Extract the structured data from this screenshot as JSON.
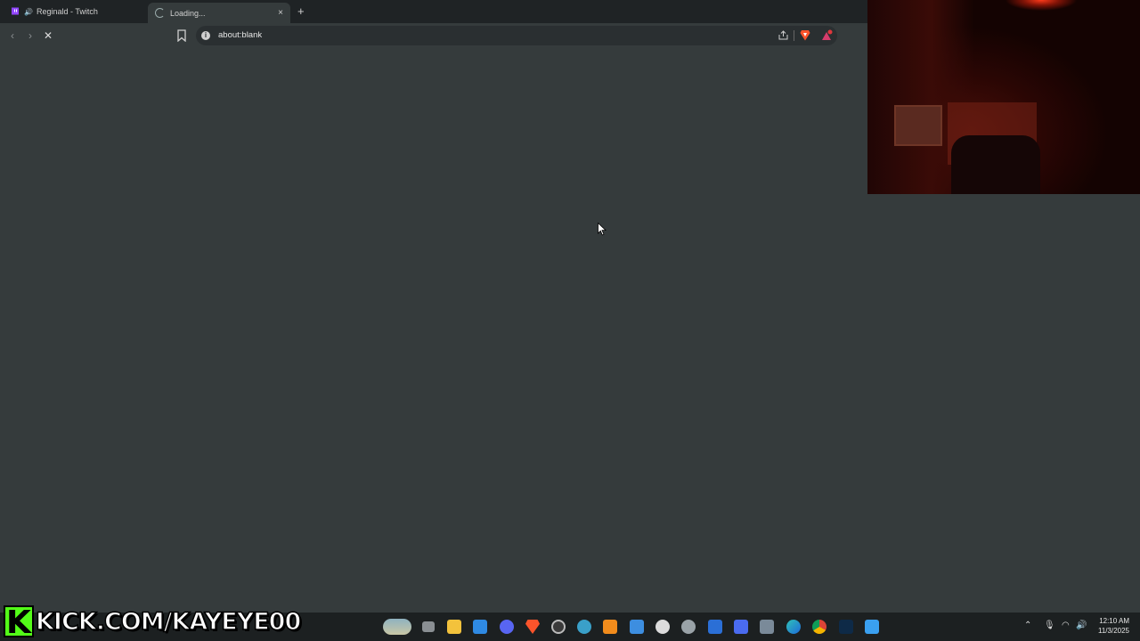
{
  "browser": {
    "tabs": [
      {
        "label": "Reginald - Twitch",
        "active": false,
        "favicon": "twitch-icon",
        "audio": true
      },
      {
        "label": "Loading...",
        "active": true,
        "favicon": "loading-spinner"
      }
    ],
    "new_tab_label": "+",
    "close_glyph": "×",
    "url": "about:blank"
  },
  "overlay": {
    "kick_logo_letter": "K",
    "kick_text": "KICK.COM/KAYEYE00"
  },
  "taskbar": {
    "time": "12:10 AM",
    "date": "11/3/2025",
    "icons": [
      "weather-icon",
      "task-view-icon",
      "file-explorer-icon",
      "store-icon",
      "discord-icon",
      "brave-icon",
      "obs-icon",
      "browser-icon",
      "fl-studio-icon",
      "notepad-icon",
      "chatgpt-icon",
      "settings-icon",
      "word-icon",
      "app-icon",
      "calculator-icon",
      "edge-icon",
      "chrome-icon",
      "terminal-icon",
      "photos-icon"
    ]
  },
  "colors": {
    "page_bg": "#353b3c",
    "tabstrip_bg": "#1f2325",
    "kick_green": "#53fc18",
    "brave_orange": "#fb542b"
  }
}
